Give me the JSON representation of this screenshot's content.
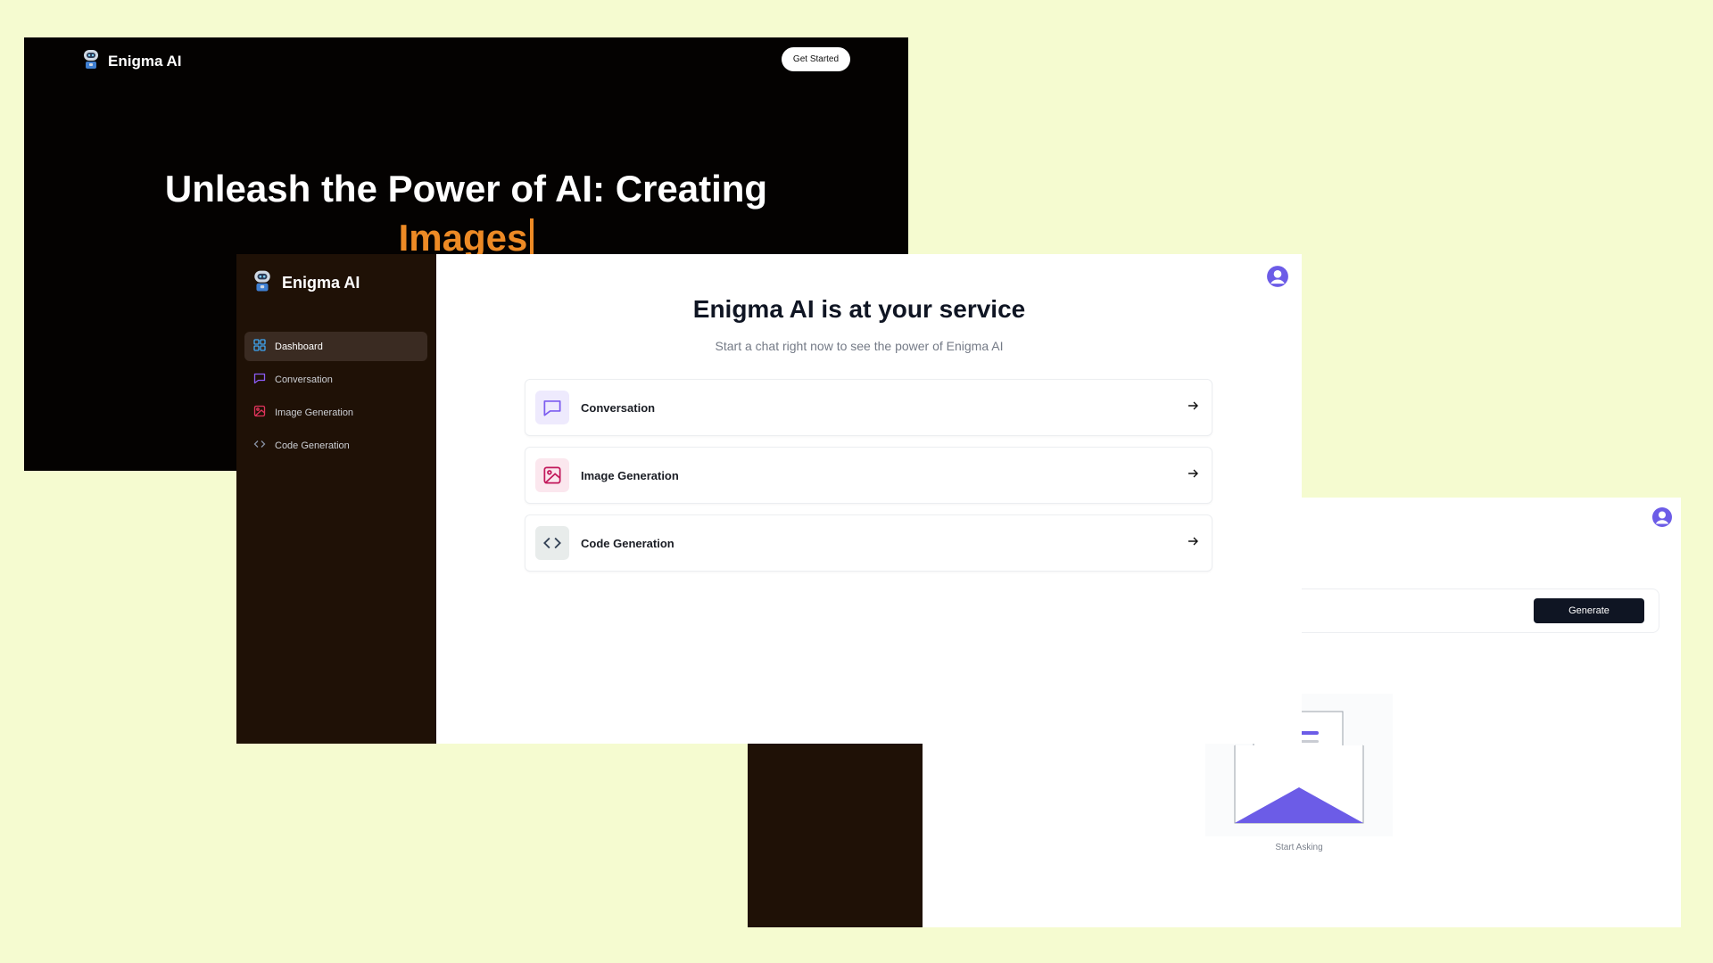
{
  "colors": {
    "background": "#f5fbd0",
    "sidebar": "#1f1106",
    "accent_orange": "#ed8a25",
    "accent_purple": "#6c5ce7",
    "danger_pink": "#c2185b",
    "code_slate": "#475569"
  },
  "landing": {
    "brand_name": "Enigma AI",
    "get_started_label": "Get Started",
    "hero_title": "Unleash the Power of AI: Creating",
    "hero_accent": "Images"
  },
  "dashboard": {
    "brand_name": "Enigma AI",
    "nav": [
      {
        "label": "Dashboard",
        "icon": "layout-grid-icon"
      },
      {
        "label": "Conversation",
        "icon": "message-square-icon"
      },
      {
        "label": "Image Generation",
        "icon": "image-icon"
      },
      {
        "label": "Code Generation",
        "icon": "code-icon"
      }
    ],
    "active_nav": "Dashboard",
    "title": "Enigma AI is at your service",
    "subtitle": "Start a chat right now to see the power of Enigma AI",
    "cards": [
      {
        "label": "Conversation",
        "icon": "message-square-icon"
      },
      {
        "label": "Image Generation",
        "icon": "image-icon"
      },
      {
        "label": "Code Generation",
        "icon": "code-icon"
      }
    ]
  },
  "generator": {
    "generate_label": "Generate",
    "empty_state_label": "Start Asking"
  }
}
